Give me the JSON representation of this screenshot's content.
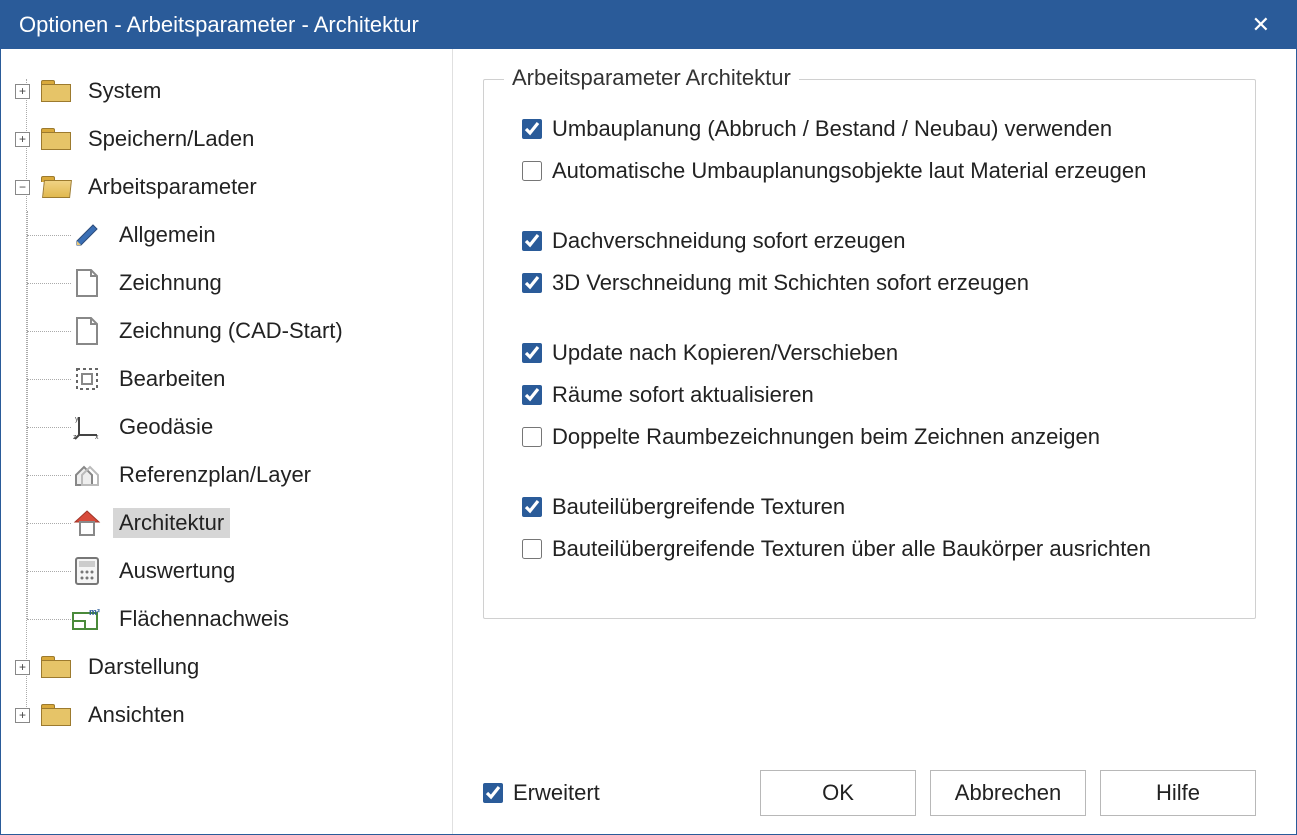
{
  "title": "Optionen - Arbeitsparameter - Architektur",
  "tree": {
    "system": "System",
    "speichern": "Speichern/Laden",
    "arbeit": "Arbeitsparameter",
    "darstellung": "Darstellung",
    "ansichten": "Ansichten",
    "items": {
      "allgemein": "Allgemein",
      "zeichnung": "Zeichnung",
      "zeichnung_cad": "Zeichnung (CAD-Start)",
      "bearbeiten": "Bearbeiten",
      "geodaesie": "Geodäsie",
      "referenzplan": "Referenzplan/Layer",
      "architektur": "Architektur",
      "auswertung": "Auswertung",
      "flaechen": "Flächennachweis"
    }
  },
  "panel": {
    "legend": "Arbeitsparameter Architektur",
    "c1": "Umbauplanung (Abbruch / Bestand / Neubau) verwenden",
    "c2": "Automatische Umbauplanungsobjekte laut Material erzeugen",
    "c3": "Dachverschneidung sofort erzeugen",
    "c4": "3D Verschneidung mit Schichten sofort erzeugen",
    "c5": "Update nach Kopieren/Verschieben",
    "c6": "Räume sofort aktualisieren",
    "c7": "Doppelte Raumbezeichnungen beim Zeichnen anzeigen",
    "c8": "Bauteilübergreifende Texturen",
    "c9": "Bauteilübergreifende Texturen über alle Baukörper ausrichten"
  },
  "footer": {
    "erweitert": "Erweitert",
    "ok": "OK",
    "cancel": "Abbrechen",
    "help": "Hilfe"
  }
}
